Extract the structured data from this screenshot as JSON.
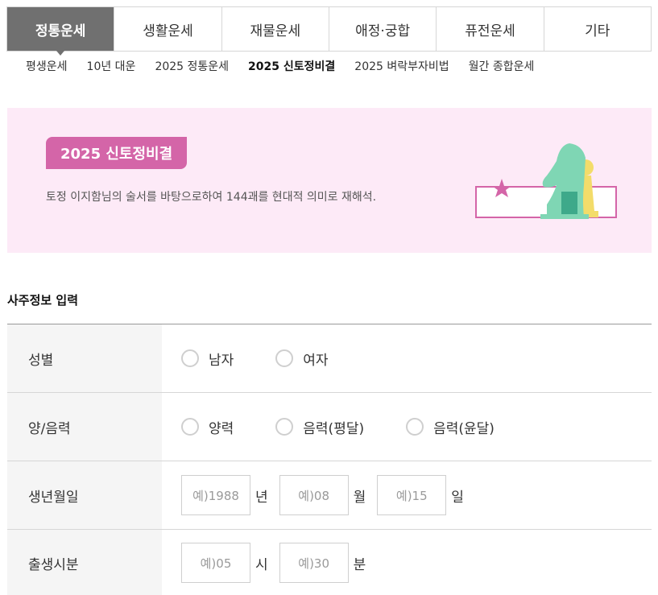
{
  "tabs": [
    {
      "label": "정통운세",
      "active": true
    },
    {
      "label": "생활운세",
      "active": false
    },
    {
      "label": "재물운세",
      "active": false
    },
    {
      "label": "애정·궁합",
      "active": false
    },
    {
      "label": "퓨전운세",
      "active": false
    },
    {
      "label": "기타",
      "active": false
    }
  ],
  "subnav": [
    {
      "label": "평생운세",
      "active": false
    },
    {
      "label": "10년 대운",
      "active": false
    },
    {
      "label": "2025 정통운세",
      "active": false
    },
    {
      "label": "2025 신토정비결",
      "active": true
    },
    {
      "label": "2025 벼락부자비법",
      "active": false
    },
    {
      "label": "월간 종합운세",
      "active": false
    }
  ],
  "banner": {
    "badge": "2025 신토정비결",
    "description": "토정 이지함님의 술서를 바탕으로하여 144괘를 현대적 의미로 재해석."
  },
  "section_title": "사주정보 입력",
  "form": {
    "gender": {
      "label": "성별",
      "options": [
        "남자",
        "여자"
      ]
    },
    "calendar": {
      "label": "양/음력",
      "options": [
        "양력",
        "음력(평달)",
        "음력(윤달)"
      ]
    },
    "birthdate": {
      "label": "생년월일",
      "year_placeholder": "예)1988",
      "year_unit": "년",
      "month_placeholder": "예)08",
      "month_unit": "월",
      "day_placeholder": "예)15",
      "day_unit": "일"
    },
    "birthtime": {
      "label": "출생시분",
      "hour_placeholder": "예)05",
      "hour_unit": "시",
      "minute_placeholder": "예)30",
      "minute_unit": "분"
    }
  },
  "colors": {
    "accent": "#d465a8",
    "banner_bg": "#fdeaf7",
    "tab_active": "#707070"
  },
  "icons": {
    "banner_art": "chess-knight-and-pawn-illustration"
  }
}
